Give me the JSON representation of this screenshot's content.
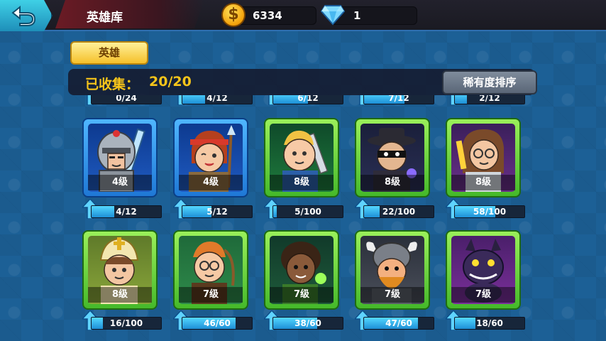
{
  "header": {
    "back_icon": "back-arrow-icon",
    "title": "英雄库",
    "coins": "6334",
    "coin_icon": "gold-coin-icon",
    "coin_symbol": "$",
    "gems": "1",
    "gem_icon": "diamond-icon"
  },
  "tabs": [
    {
      "label": "英雄"
    }
  ],
  "collection": {
    "label": "已收集：",
    "value": "20/20",
    "sort_label": "稀有度排序"
  },
  "colors": {
    "coin": "#f3a10a",
    "collected_text": "#f7c51a",
    "blue_card": "#1f78d6",
    "green_card": "#45b92a"
  },
  "peek_row": [
    "0/24",
    "4/12",
    "6/12",
    "7/12",
    "2/12"
  ],
  "heroes": [
    {
      "name": "knight",
      "frame": "blue",
      "level": "4级",
      "progress": "4/12",
      "fill": 0.33
    },
    {
      "name": "spear-girl",
      "frame": "blue",
      "level": "4级",
      "progress": "5/12",
      "fill": 0.42
    },
    {
      "name": "sword-boy",
      "frame": "green",
      "level": "8级",
      "progress": "5/100",
      "fill": 0.05
    },
    {
      "name": "masked-thief",
      "frame": "green",
      "level": "8级",
      "progress": "22/100",
      "fill": 0.22
    },
    {
      "name": "mage-girl",
      "frame": "green",
      "level": "8级",
      "progress": "58/100",
      "fill": 0.58
    },
    {
      "name": "priest",
      "frame": "green",
      "level": "8级",
      "progress": "16/100",
      "fill": 0.16
    },
    {
      "name": "archer-girl",
      "frame": "green",
      "level": "7级",
      "progress": "46/60",
      "fill": 0.77
    },
    {
      "name": "druid-girl",
      "frame": "green",
      "level": "7级",
      "progress": "38/60",
      "fill": 0.63
    },
    {
      "name": "viking",
      "frame": "green",
      "level": "7级",
      "progress": "47/60",
      "fill": 0.78
    },
    {
      "name": "dragon",
      "frame": "green",
      "level": "7级",
      "progress": "18/60",
      "fill": 0.3
    }
  ]
}
